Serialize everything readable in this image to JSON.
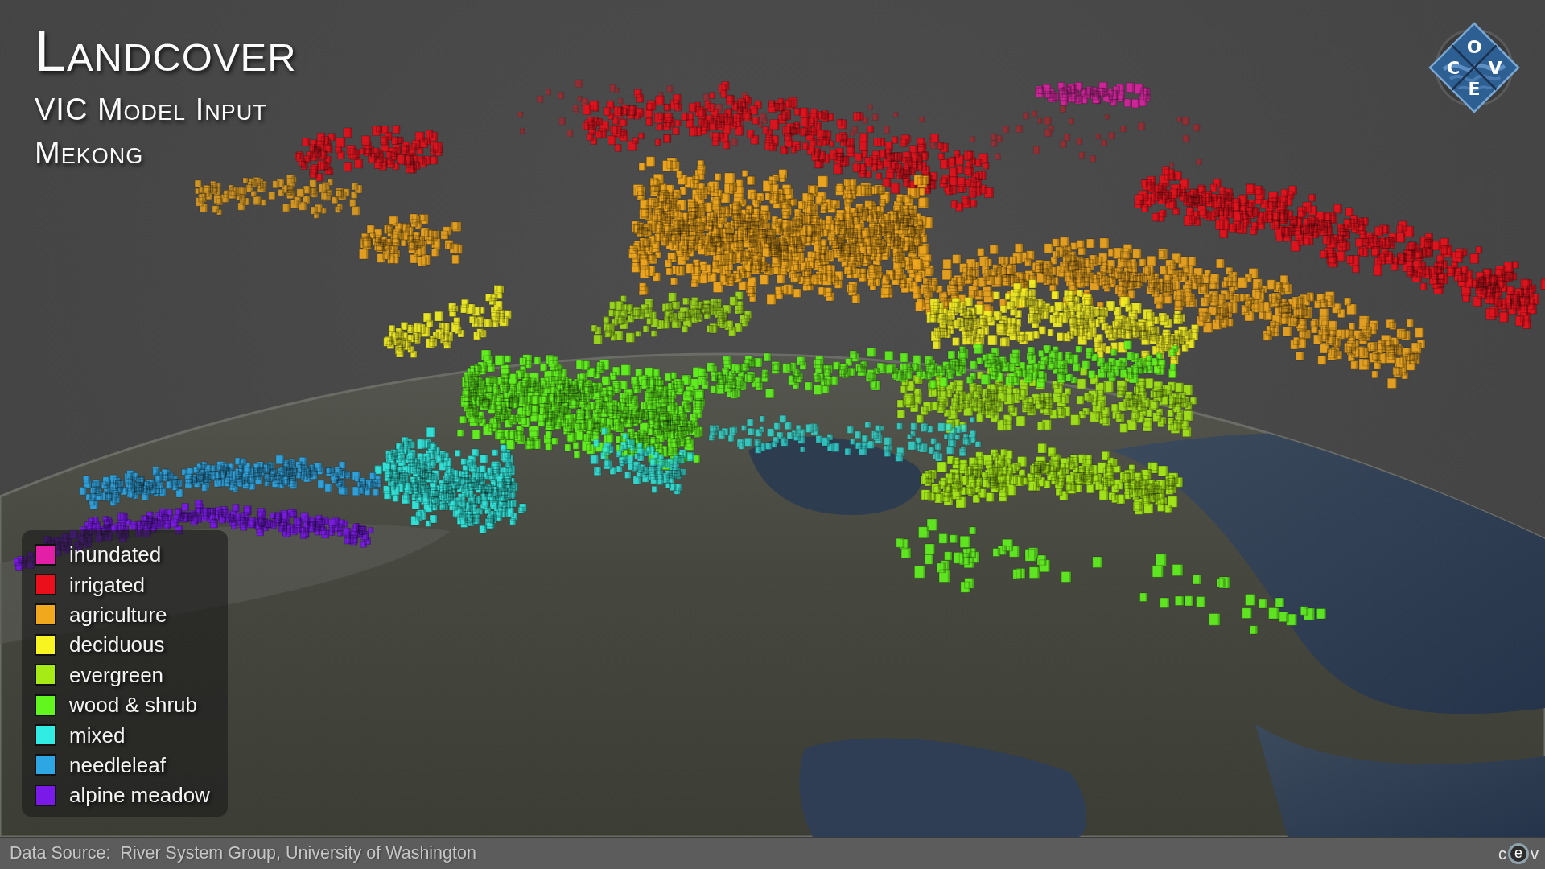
{
  "title": {
    "heading": "Landcover",
    "subtitle": "VIC Model Input",
    "region": "Mekong"
  },
  "logo": {
    "top": "O",
    "left": "C",
    "right": "V",
    "bottom": "E"
  },
  "legend": {
    "items": [
      {
        "label": "inundated",
        "color": "#e21fa6"
      },
      {
        "label": "irrigated",
        "color": "#ea0f1b"
      },
      {
        "label": "agriculture",
        "color": "#f2a81c"
      },
      {
        "label": "deciduous",
        "color": "#f8f422"
      },
      {
        "label": "evergreen",
        "color": "#a6ea16"
      },
      {
        "label": "wood & shrub",
        "color": "#62f51e"
      },
      {
        "label": "mixed",
        "color": "#30ece2"
      },
      {
        "label": "needleleaf",
        "color": "#2fa6e4"
      },
      {
        "label": "alpine meadow",
        "color": "#7a19e8"
      }
    ]
  },
  "footer": {
    "source": "Data Source:  River System Group, University of Washington",
    "logo_letters": [
      "c",
      "e",
      "v"
    ]
  }
}
